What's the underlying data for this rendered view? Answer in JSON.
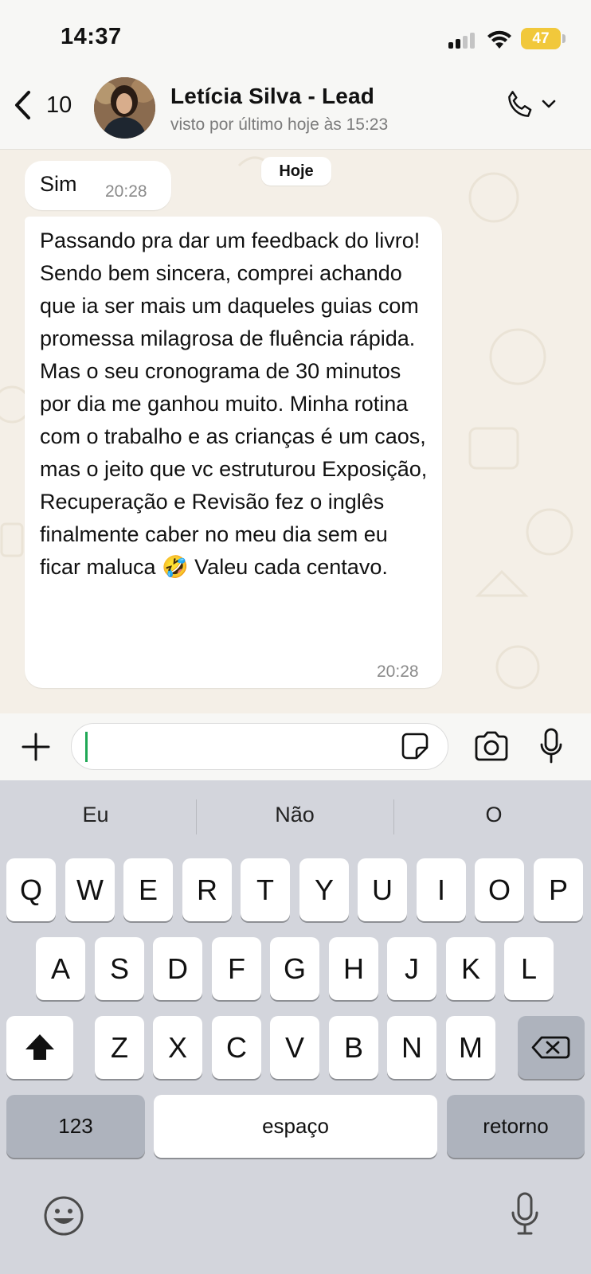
{
  "status_bar": {
    "time": "14:37",
    "battery": "47"
  },
  "header": {
    "back_count": "10",
    "contact_name": "Letícia Silva - Lead",
    "last_seen": "visto por último hoje às 15:23"
  },
  "chat": {
    "day_badge": "Hoje",
    "messages": [
      {
        "text": "Sim",
        "time": "20:28"
      },
      {
        "text": "Passando pra dar um feedback do livro! Sendo bem sincera, comprei achando que ia ser mais um daqueles guias com promessa milagrosa de fluência rápida. Mas o seu cronograma de 30 minutos por dia me ganhou muito. Minha rotina com o trabalho e as crianças é um caos, mas o jeito que vc estruturou Exposição, Recuperação e Revisão fez o inglês finalmente caber no meu dia sem eu ficar maluca 🤣 Valeu cada centavo.",
        "time": "20:28"
      }
    ]
  },
  "input": {
    "value": ""
  },
  "keyboard": {
    "suggestions": [
      "Eu",
      "Não",
      "O"
    ],
    "row1": [
      "Q",
      "W",
      "E",
      "R",
      "T",
      "Y",
      "U",
      "I",
      "O",
      "P"
    ],
    "row2": [
      "A",
      "S",
      "D",
      "F",
      "G",
      "H",
      "J",
      "K",
      "L"
    ],
    "row3": [
      "Z",
      "X",
      "C",
      "V",
      "B",
      "N",
      "M"
    ],
    "numbers_label": "123",
    "space_label": "espaço",
    "return_label": "retorno"
  },
  "icons": {
    "signal": "signal-bars-icon",
    "wifi": "wifi-icon",
    "back": "chevron-left-icon",
    "call": "phone-icon",
    "call_menu": "chevron-down-icon",
    "plus": "plus-icon",
    "sticker": "sticker-icon",
    "camera": "camera-icon",
    "mic": "microphone-icon",
    "shift": "shift-icon",
    "delete": "backspace-icon",
    "emoji": "emoji-icon",
    "dictation": "dictation-mic-icon"
  },
  "colors": {
    "accent": "#1fa855",
    "battery": "#f1c83b",
    "chat_bg": "#f4efe7"
  }
}
